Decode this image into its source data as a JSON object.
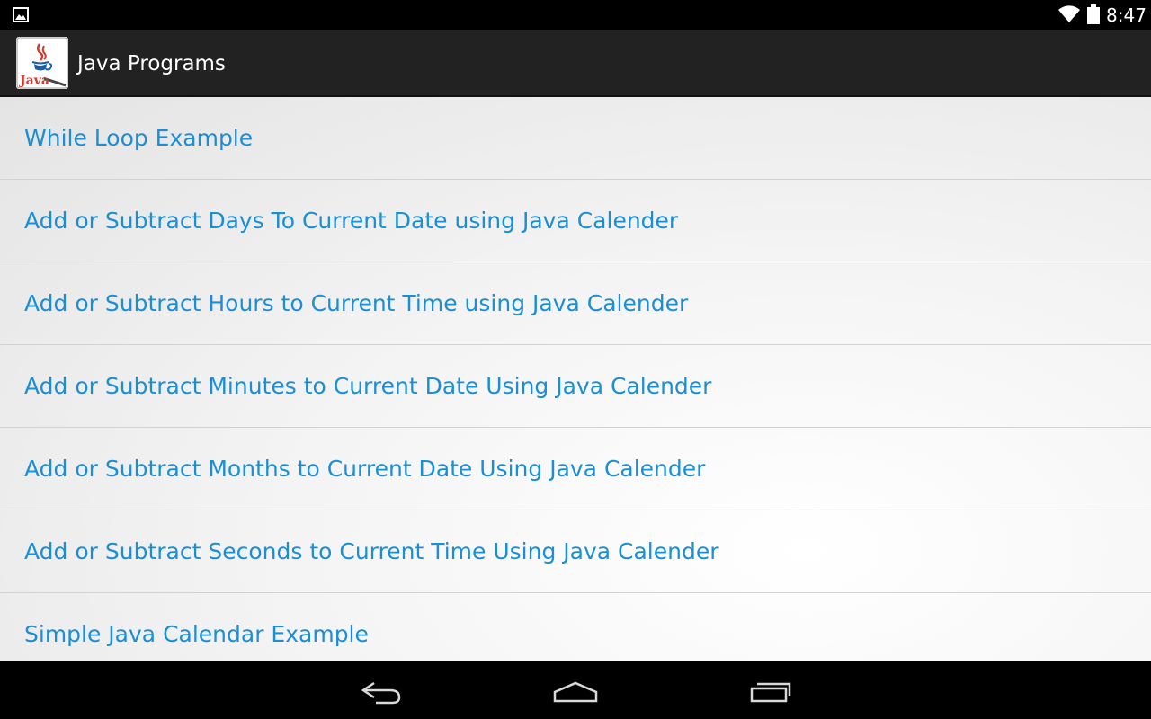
{
  "status_bar": {
    "time": "8:47",
    "icons": [
      "gallery-icon",
      "wifi-icon",
      "battery-icon"
    ]
  },
  "action_bar": {
    "title": "Java Programs",
    "app_icon": "java-logo-icon",
    "app_icon_text": "Java"
  },
  "list": {
    "items": [
      {
        "label": "While Loop Example"
      },
      {
        "label": "Add or Subtract Days To Current Date using Java Calender"
      },
      {
        "label": "Add or Subtract Hours to Current Time using Java Calender"
      },
      {
        "label": "Add or Subtract Minutes to Current Date Using Java Calender"
      },
      {
        "label": "Add or Subtract Months to Current Date Using Java Calender"
      },
      {
        "label": "Add or Subtract Seconds to Current Time Using Java Calender"
      },
      {
        "label": "Simple Java Calendar Example"
      }
    ],
    "text_color": "#1b8fd6"
  },
  "nav_bar": {
    "buttons": [
      "back-icon",
      "home-icon",
      "recents-icon"
    ]
  }
}
